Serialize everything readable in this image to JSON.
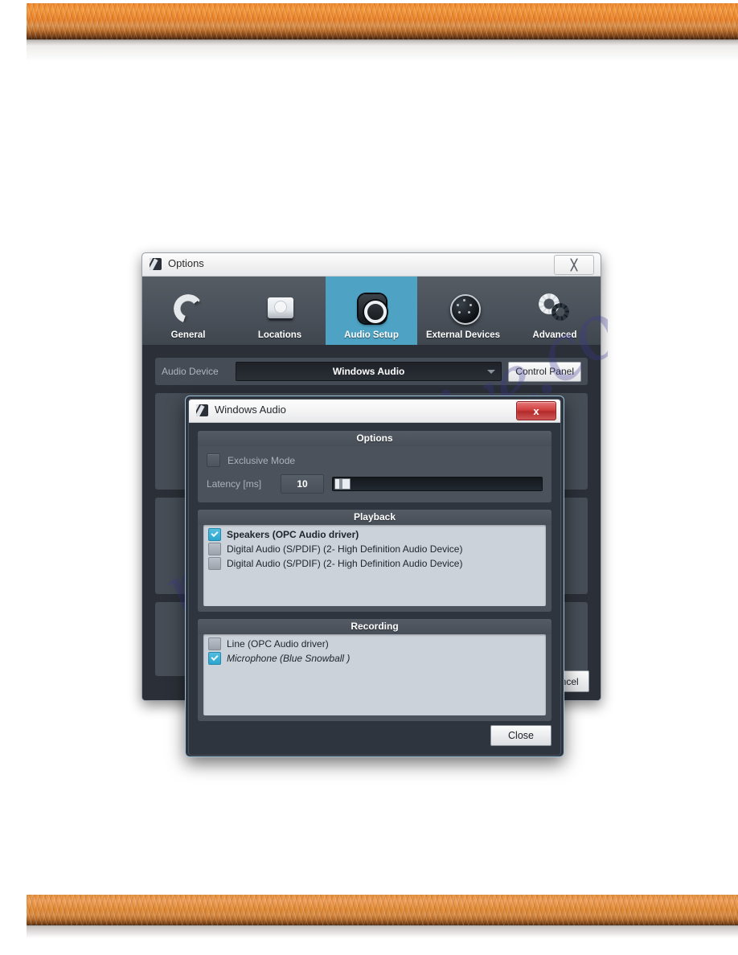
{
  "page": {
    "watermark_text": "manualshive.com"
  },
  "options_window": {
    "title": "Options",
    "close_label": "╳",
    "app_icon": "app-logo-icon",
    "tabs": [
      {
        "label": "General",
        "icon": "refresh-circle-icon",
        "active": false
      },
      {
        "label": "Locations",
        "icon": "hard-drive-icon",
        "active": false
      },
      {
        "label": "Audio Setup",
        "icon": "audio-jack-icon",
        "active": true
      },
      {
        "label": "External Devices",
        "icon": "rotary-knob-icon",
        "active": false
      },
      {
        "label": "Advanced",
        "icon": "gears-icon",
        "active": false
      }
    ],
    "audio_device": {
      "label": "Audio Device",
      "value": "Windows Audio",
      "dropdown_icon": "chevron-down-icon",
      "control_panel_button": "Control Panel"
    },
    "footer_buttons": [
      "Cancel"
    ]
  },
  "windows_audio_dialog": {
    "title": "Windows Audio",
    "app_icon": "app-logo-icon",
    "close_x_label": "x",
    "groups": {
      "options": {
        "header": "Options",
        "exclusive_mode": {
          "label": "Exclusive Mode",
          "checked": false
        },
        "latency": {
          "label": "Latency [ms]",
          "value": "10",
          "slider_position_pct": 3
        }
      },
      "playback": {
        "header": "Playback",
        "devices": [
          {
            "label": "Speakers (OPC Audio driver)",
            "checked": true,
            "bold": true,
            "italic": false
          },
          {
            "label": "Digital Audio (S/PDIF) (2- High Definition Audio Device)",
            "checked": false,
            "bold": false,
            "italic": false
          },
          {
            "label": "Digital Audio (S/PDIF) (2- High Definition Audio Device)",
            "checked": false,
            "bold": false,
            "italic": false
          }
        ]
      },
      "recording": {
        "header": "Recording",
        "devices": [
          {
            "label": "Line (OPC Audio driver)",
            "checked": false,
            "bold": false,
            "italic": false
          },
          {
            "label": "Microphone (Blue Snowball )",
            "checked": true,
            "bold": false,
            "italic": true
          }
        ]
      }
    },
    "close_button": "Close"
  },
  "colors": {
    "accent_tab": "#4ea3c4",
    "dialog_bg": "#2f353e",
    "group_bg": "#4b525b",
    "list_bg": "#ccd2da",
    "close_red": "#d0403f",
    "banner_orange": "#e98229"
  }
}
